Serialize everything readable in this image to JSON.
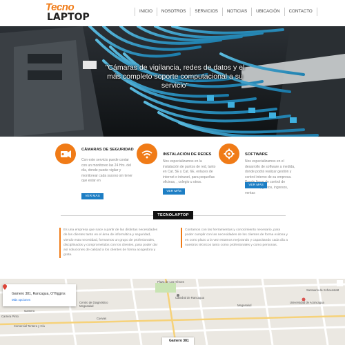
{
  "brand": {
    "logo_top": "Tecno",
    "logo_bottom": "LAPTOP",
    "accent": "#f07b17",
    "button_blue": "#1d7ec4"
  },
  "nav": [
    "INICIO",
    "NOSOTROS",
    "SERVICIOS",
    "NOTICIAS",
    "UBICACIÓN",
    "CONTACTO"
  ],
  "hero": {
    "caption": "\"Cámaras de vigilancia, redes de datos y el más completo soporte computacional a su servicio\""
  },
  "services": [
    {
      "icon": "camera-icon",
      "title": "CÁMARAS DE SEGURIDAD",
      "text": "Con este servicio puede contar con un monitoreo las 24 Hrs. del día, donde puede vigilar y monitorear cada suceso sin tener que estar en",
      "button": "VER MÁS"
    },
    {
      "icon": "wifi-icon",
      "title": "INSTALACIÓN DE REDES",
      "text": "Nos especializamos en la instalación de puntos de red, tanto en Cat. 5E y Cat. 6E, enlaces de internet e intranet, para pequeñas oficinas, , colegio u otros.",
      "button": "VER MÁS"
    },
    {
      "icon": "software-icon",
      "title": "SOFTWARE",
      "text": "Nos especializamos en el desarrollo de software a medida, donde podrá realizar gestión y control interno de su empresa. Puede llevar de control de inventario, gastos, ingresos, ventas",
      "button": "VER MÁS"
    }
  ],
  "section": {
    "tag": "TECNOLAPTOP"
  },
  "about": {
    "left": "Es una empresa que nace a partir de las distintas necesidades de los clientes tanto en el área de informática y seguridad, viendo esta necesidad, formamos un grupo de profesionales, disciplinados y comprometidos con los clientes, para poder dar así soluciones de calidad a los clientes de forma acogedora y grata.",
    "right": "Contamos con las herramientas y conocimiento necesario, para poder cumplir con las necesidades de los clientes de forma exitosa y en corto plazo a la vez estamos mejorando y capacitando cada día a nuestros técnicos tanto como profesionales y como personas."
  },
  "map": {
    "address": "Gamero 381, Rancagua, O'Higgins",
    "link": "Más opciones",
    "labels": {
      "plaza": "Plaza de Los Héroes",
      "centro": "Centro de Diagnóstico Megasalud",
      "catedral": "Catedral de Rancagua",
      "megasalud": "Megasalud",
      "cuevas": "Cuevas",
      "gamero_st": "Gamero",
      "carrera": "Carrera Pinto",
      "santuario": "Santuario de Schoenstatt",
      "universidad": "Universidad de Aconcagua",
      "comercial": "Comercial Tentera y Cía",
      "bubble": "Gamero 381"
    }
  }
}
